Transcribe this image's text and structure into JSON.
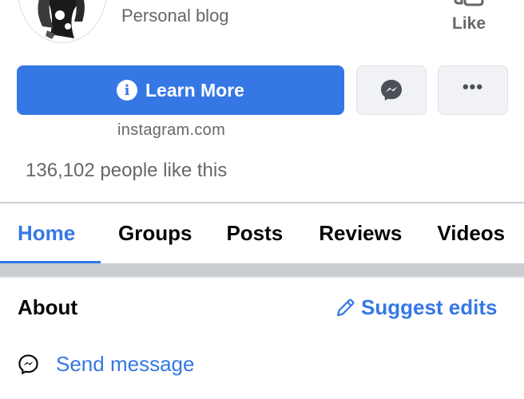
{
  "header": {
    "category": "Personal blog",
    "like_label": "Like"
  },
  "actions": {
    "learn_more_label": "Learn More",
    "info_glyph": "i",
    "more_glyph": "•••"
  },
  "page": {
    "website": "instagram.com",
    "likes_text": "136,102 people like this"
  },
  "tabs": [
    {
      "label": "Home",
      "active": true
    },
    {
      "label": "Groups",
      "active": false
    },
    {
      "label": "Posts",
      "active": false
    },
    {
      "label": "Reviews",
      "active": false
    },
    {
      "label": "Videos",
      "active": false
    }
  ],
  "about": {
    "title": "About",
    "suggest_label": "Suggest edits",
    "send_message_label": "Send message"
  },
  "colors": {
    "accent": "#3578e5",
    "secondary_text": "#65676b",
    "button_gray": "#f0f2f5"
  },
  "icons": {
    "info": "info-icon",
    "messenger": "messenger-icon",
    "more": "more-dots-icon",
    "like": "thumbs-up-icon",
    "pencil": "pencil-icon"
  }
}
